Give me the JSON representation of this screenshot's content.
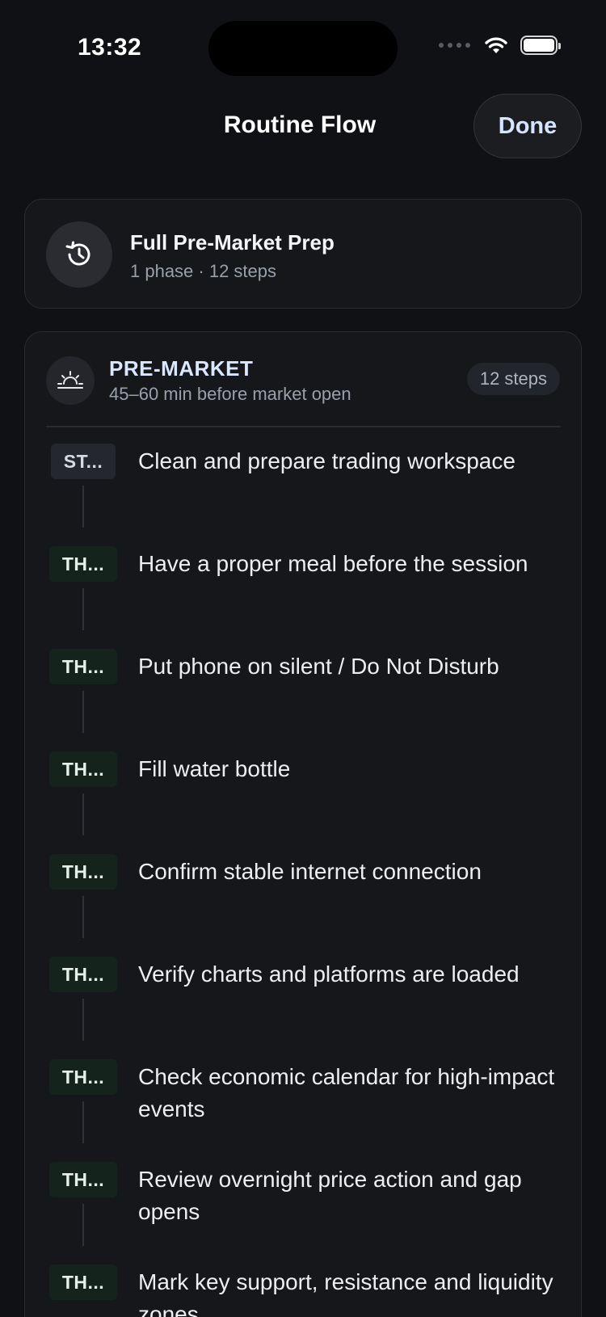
{
  "status_bar": {
    "time": "13:32"
  },
  "nav": {
    "title": "Routine Flow",
    "done_label": "Done"
  },
  "routine": {
    "title": "Full Pre-Market Prep",
    "subtitle": "1 phase · 12 steps"
  },
  "phase": {
    "name": "PRE-MARKET",
    "description": "45–60 min before market open",
    "steps_badge": "12 steps",
    "steps": [
      {
        "tag": "ST...",
        "kind": "st",
        "text": "Clean and prepare trading workspace"
      },
      {
        "tag": "TH...",
        "kind": "th",
        "text": "Have a proper meal before the session"
      },
      {
        "tag": "TH...",
        "kind": "th",
        "text": "Put phone on silent / Do Not Disturb"
      },
      {
        "tag": "TH...",
        "kind": "th",
        "text": "Fill water bottle"
      },
      {
        "tag": "TH...",
        "kind": "th",
        "text": "Confirm stable internet connection"
      },
      {
        "tag": "TH...",
        "kind": "th",
        "text": "Verify charts and platforms are loaded"
      },
      {
        "tag": "TH...",
        "kind": "th",
        "text": "Check economic calendar for high-impact events"
      },
      {
        "tag": "TH...",
        "kind": "th",
        "text": "Review overnight price action and gap opens"
      },
      {
        "tag": "TH...",
        "kind": "th",
        "text": "Mark key support, resistance and liquidity zones"
      }
    ]
  }
}
